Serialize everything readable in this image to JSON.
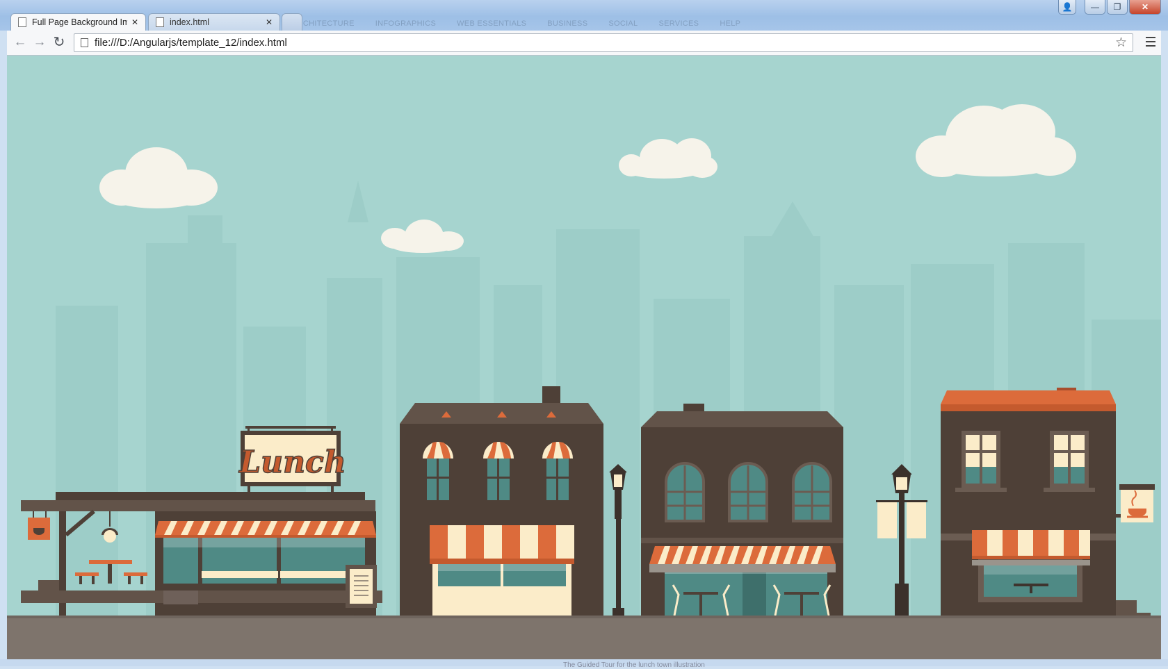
{
  "window": {
    "tabs": [
      {
        "title": "Full Page Background Ima",
        "close": "✕"
      },
      {
        "title": "index.html",
        "close": "✕"
      }
    ],
    "controls": {
      "user": "👤",
      "minimize": "—",
      "restore": "❐",
      "close": "✕"
    },
    "background_menu": [
      "ARCHITECTURE",
      "INFOGRAPHICS",
      "WEB ESSENTIALS",
      "BUSINESS",
      "SOCIAL",
      "SERVICES",
      "HELP"
    ]
  },
  "toolbar": {
    "back": "←",
    "forward": "→",
    "reload": "↻",
    "url": "file:///D:/Angularjs/template_12/index.html",
    "bookmark_star": "☆"
  },
  "page": {
    "lunch_sign": "Lunch",
    "colors": {
      "sky": "#a6d4cf",
      "building_dark": "#4e4037",
      "roof": "#625349",
      "accent_orange": "#dc6b3b",
      "cream": "#fbecc9",
      "window_teal": "#4f8a85",
      "street": "#7e746c"
    }
  },
  "status": {
    "bottom_text": "The Guided Tour for the lunch town illustration"
  }
}
